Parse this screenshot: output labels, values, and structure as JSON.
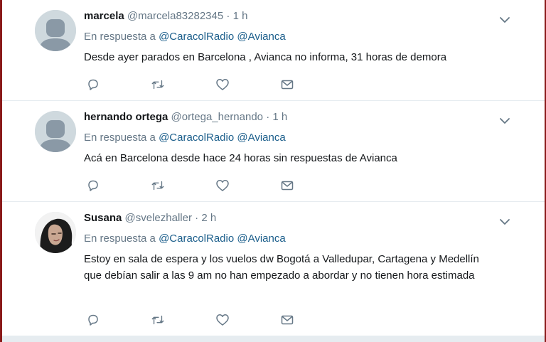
{
  "tweets": [
    {
      "name": "marcela",
      "handle": "@marcela83282345",
      "separator": "·",
      "time": "1 h",
      "reply_prefix": "En respuesta a",
      "mentions": [
        "@CaracolRadio",
        "@Avianca"
      ],
      "text": "Desde ayer parados en Barcelona , Avianca no informa, 31 horas de demora",
      "avatar": "default-avatar-icon"
    },
    {
      "name": "hernando ortega",
      "handle": "@ortega_hernando",
      "separator": "·",
      "time": "1 h",
      "reply_prefix": "En respuesta a",
      "mentions": [
        "@CaracolRadio",
        "@Avianca"
      ],
      "text": "Acá en Barcelona desde hace 24 horas sin respuestas de Avianca",
      "avatar": "default-avatar-icon"
    },
    {
      "name": "Susana",
      "handle": "@svelezhaller",
      "separator": "·",
      "time": "2 h",
      "reply_prefix": "En respuesta a",
      "mentions": [
        "@CaracolRadio",
        "@Avianca"
      ],
      "text": "Estoy en sala de espera y los vuelos dw Bogotá a Valledupar, Cartagena y Medellín que debían salir a las 9 am no han empezado a abordar y no tienen hora estimada",
      "avatar": "photo-avatar"
    }
  ],
  "icons": [
    "reply-icon",
    "retweet-icon",
    "like-icon",
    "direct-message-icon",
    "chevron-down-icon"
  ],
  "colors": {
    "text": "#14171a",
    "secondary": "#657786",
    "mention": "#1b5e8b",
    "divider": "#e6ecf0",
    "edge": "#8a1a1a"
  }
}
